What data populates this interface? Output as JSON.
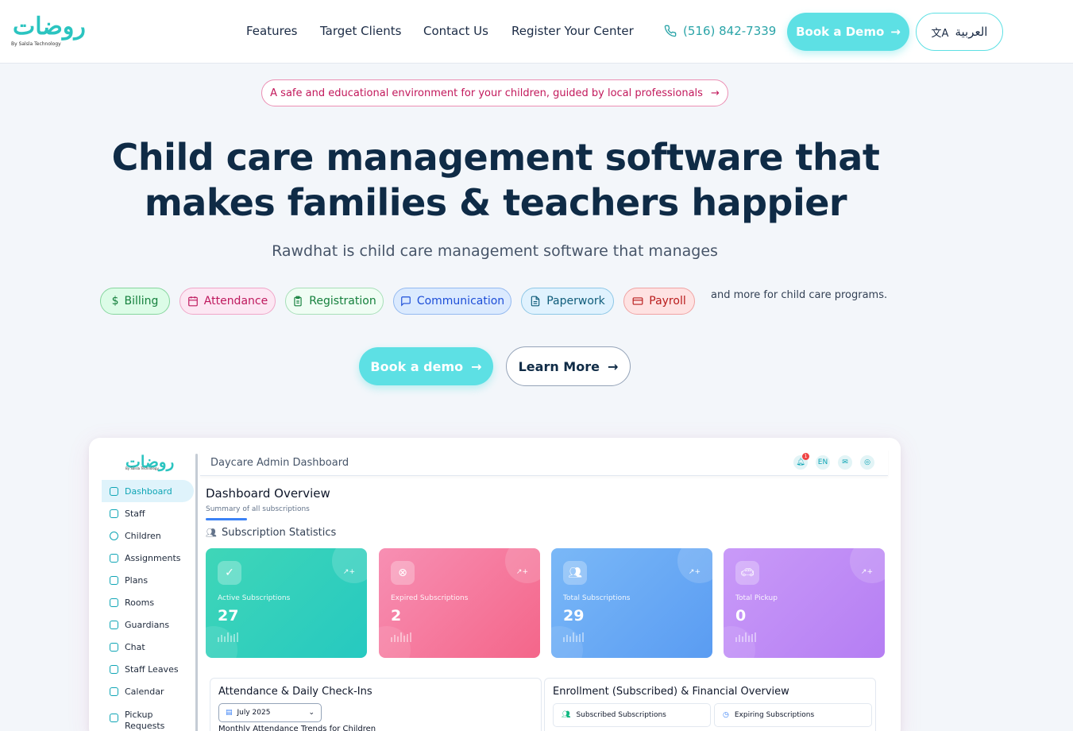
{
  "brand": {
    "logo_text": "روضات",
    "tagline": "By Salsla Technology"
  },
  "nav": {
    "items": [
      "Features",
      "Target Clients",
      "Contact Us",
      "Register Your Center"
    ],
    "phone": "(516) 842-7339",
    "book_demo": "Book a Demo",
    "language": "العربية"
  },
  "hero": {
    "announcement": "A safe and educational environment for your children, guided by local professionals",
    "headline_line1": "Child care management software that",
    "headline_line2": "makes families & teachers happier",
    "subtitle": "Rawdhat is child care management software that manages",
    "tags": [
      {
        "label": "Billing",
        "icon": "dollar-icon",
        "color": "#15803d"
      },
      {
        "label": "Attendance",
        "icon": "calendar-icon",
        "color": "#be185d"
      },
      {
        "label": "Registration",
        "icon": "clipboard-icon",
        "color": "#15803d"
      },
      {
        "label": "Communication",
        "icon": "chat-icon",
        "color": "#1d4ed8"
      },
      {
        "label": "Paperwork",
        "icon": "document-icon",
        "color": "#0f5c7a"
      },
      {
        "label": "Payroll",
        "icon": "card-icon",
        "color": "#b91c1c"
      }
    ],
    "tags_suffix": "and more for child care programs.",
    "cta_primary": "Book a demo",
    "cta_secondary": "Learn More"
  },
  "dashboard": {
    "logo_text": "روضات",
    "logo_tagline": "By Salsla Technology",
    "header_title": "Daycare Admin Dashboard",
    "notification_count": "1",
    "lang_badge": "EN",
    "sidebar": [
      "Dashboard",
      "Staff",
      "Children",
      "Assignments",
      "Plans",
      "Rooms",
      "Guardians",
      "Chat",
      "Staff Leaves",
      "Calendar",
      "Pickup Requests"
    ],
    "overview_title": "Dashboard Overview",
    "overview_subtitle": "Summary of all subscriptions",
    "stats_title": "Subscription Statistics",
    "cards": [
      {
        "label": "Active Subscriptions",
        "value": "27",
        "icon": "check-circle-icon"
      },
      {
        "label": "Expired Subscriptions",
        "value": "2",
        "icon": "x-circle-icon"
      },
      {
        "label": "Total Subscriptions",
        "value": "29",
        "icon": "users-icon"
      },
      {
        "label": "Total Pickup",
        "value": "0",
        "icon": "car-icon"
      }
    ],
    "attendance_title": "Attendance & Daily Check-Ins",
    "month_select": "July 2025",
    "attendance_trend": "Monthly Attendance Trends for Children",
    "enrollment_title": "Enrollment (Subscribed) & Financial Overview",
    "subscribed_label": "Subscribed Subscriptions",
    "expiring_label": "Expiring Subscriptions"
  },
  "colors": {
    "accent": "#5de0e4",
    "navy": "#0f2b46",
    "pink": "#c2185b"
  }
}
